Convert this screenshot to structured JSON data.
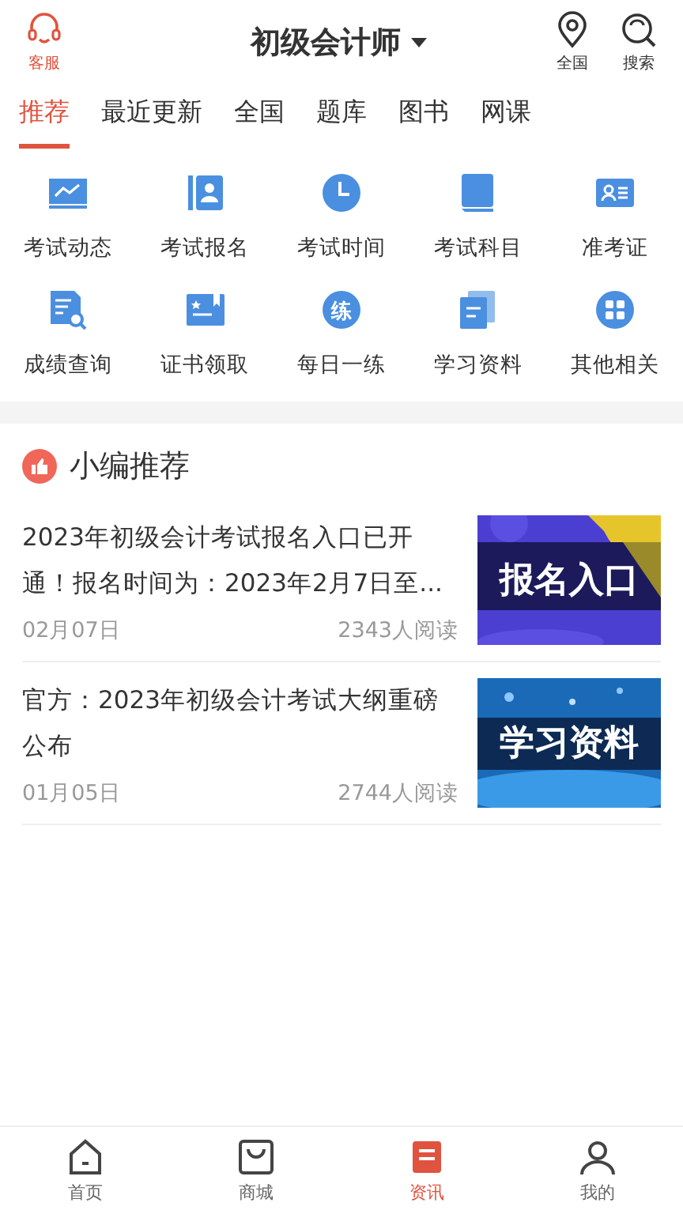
{
  "header": {
    "service_label": "客服",
    "title": "初级会计师",
    "actions": [
      {
        "kind": "location",
        "label": "全国"
      },
      {
        "kind": "search",
        "label": "搜索"
      }
    ]
  },
  "tabs": [
    {
      "label": "推荐",
      "selected": true
    },
    {
      "label": "最近更新",
      "selected": false
    },
    {
      "label": "全国",
      "selected": false
    },
    {
      "label": "题库",
      "selected": false
    },
    {
      "label": "图书",
      "selected": false
    },
    {
      "label": "网课",
      "selected": false
    }
  ],
  "shortcuts": [
    {
      "kind": "chart",
      "label": "考试动态"
    },
    {
      "kind": "contact",
      "label": "考试报名"
    },
    {
      "kind": "clock",
      "label": "考试时间"
    },
    {
      "kind": "book",
      "label": "考试科目"
    },
    {
      "kind": "card",
      "label": "准考证"
    },
    {
      "kind": "doc-search",
      "label": "成绩查询"
    },
    {
      "kind": "certificate",
      "label": "证书领取"
    },
    {
      "kind": "practice",
      "label": "每日一练",
      "glyph": "练"
    },
    {
      "kind": "files",
      "label": "学习资料"
    },
    {
      "kind": "grid",
      "label": "其他相关"
    }
  ],
  "section": {
    "title": "小编推荐"
  },
  "articles": [
    {
      "title": "2023年初级会计考试报名入口已开通！报名时间为：2023年2月7日至...",
      "date": "02月07日",
      "reads": "2343人阅读",
      "thumb": {
        "kind": "purple",
        "text": "报名入口"
      }
    },
    {
      "title": "官方：2023年初级会计考试大纲重磅公布",
      "date": "01月05日",
      "reads": "2744人阅读",
      "thumb": {
        "kind": "blue",
        "text": "学习资料"
      }
    }
  ],
  "bottom_nav": [
    {
      "kind": "home",
      "label": "首页",
      "selected": false
    },
    {
      "kind": "shop",
      "label": "商城",
      "selected": false
    },
    {
      "kind": "news",
      "label": "资讯",
      "selected": true
    },
    {
      "kind": "user",
      "label": "我的",
      "selected": false
    }
  ]
}
